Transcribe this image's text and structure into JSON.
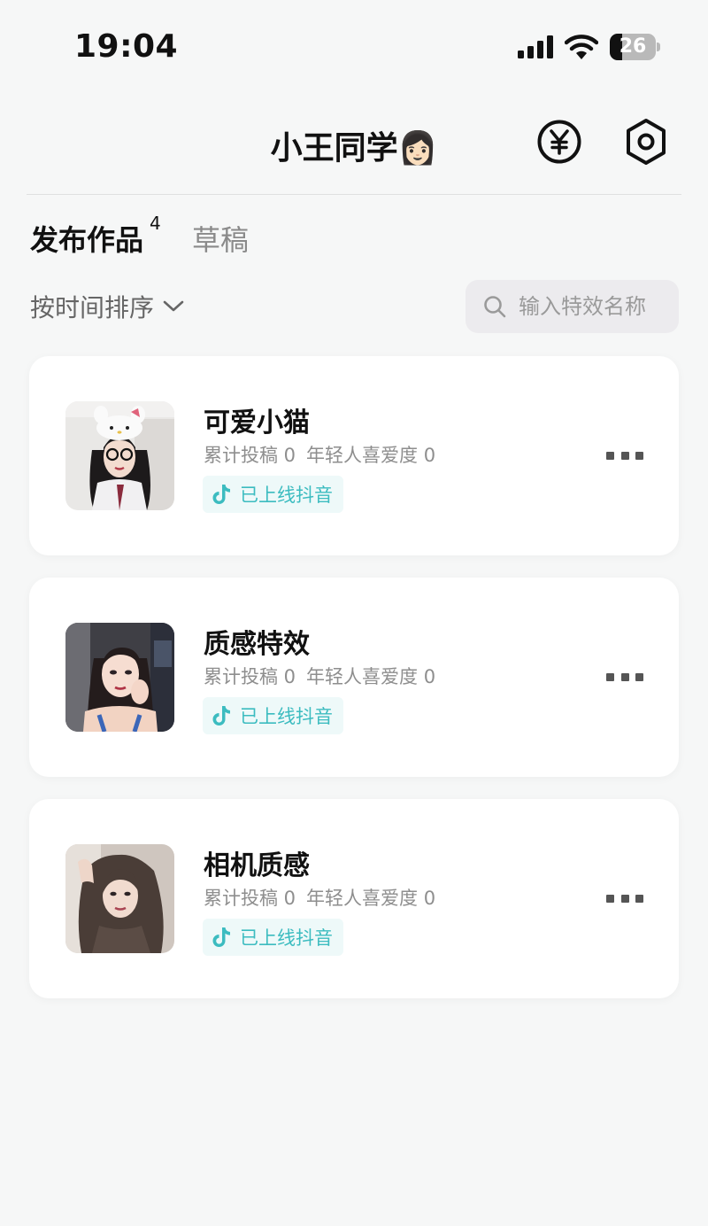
{
  "status_bar": {
    "time": "19:04",
    "battery_level": "26",
    "battery_percent": 26,
    "icons": [
      "signal-icon",
      "wifi-icon",
      "battery-icon"
    ]
  },
  "header": {
    "title": "小王同学👩🏻",
    "actions": [
      "yuan-icon",
      "settings-icon"
    ]
  },
  "tabs": [
    {
      "label": "发布作品",
      "count": "4",
      "active": true
    },
    {
      "label": "草稿",
      "active": false
    }
  ],
  "sort": {
    "label": "按时间排序",
    "icon": "chevron-down-icon"
  },
  "search": {
    "placeholder": "输入特效名称",
    "value": "",
    "icon": "search-icon"
  },
  "items": [
    {
      "title": "可爱小猫",
      "submissions_label": "累计投稿 0",
      "popularity_label": "年轻人喜爱度 0",
      "status": "已上线抖音",
      "thumbnail": "girl-with-cat-ears-hat-photo"
    },
    {
      "title": "质感特效",
      "submissions_label": "累计投稿 0",
      "popularity_label": "年轻人喜爱度 0",
      "status": "已上线抖音",
      "thumbnail": "girl-hand-on-cheek-photo"
    },
    {
      "title": "相机质感",
      "submissions_label": "累计投稿 0",
      "popularity_label": "年轻人喜爱度 0",
      "status": "已上线抖音",
      "thumbnail": "girl-long-hair-photo"
    }
  ],
  "colors": {
    "background": "#f6f7f7",
    "card": "#ffffff",
    "accent_teal": "#3cbcc0",
    "badge_bg": "#eef9f9",
    "search_bg": "#ecebee"
  }
}
